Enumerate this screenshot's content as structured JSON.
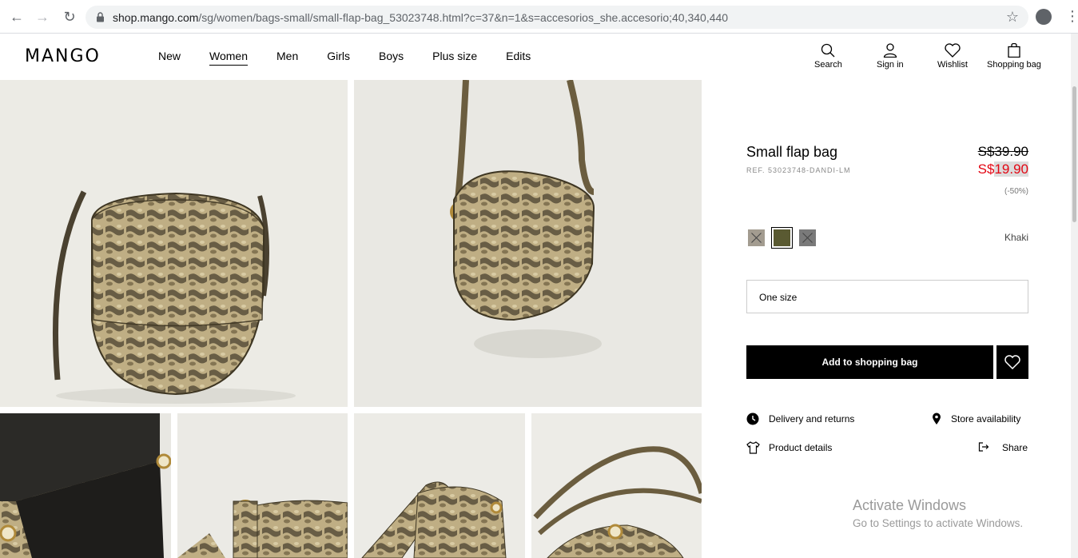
{
  "browser": {
    "url_host": "shop.mango.com",
    "url_path": "/sg/women/bags-small/small-flap-bag_53023748.html?c=37&n=1&s=accesorios_she.accesorio;40,340,440"
  },
  "header": {
    "logo": "MANGO",
    "nav": [
      "New",
      "Women",
      "Men",
      "Girls",
      "Boys",
      "Plus size",
      "Edits"
    ],
    "active_nav": "Women",
    "actions": {
      "search": "Search",
      "sign_in": "Sign in",
      "wishlist": "Wishlist",
      "shopping_bag": "Shopping bag"
    }
  },
  "product": {
    "title": "Small flap bag",
    "ref": "REF. 53023748-DANDI-LM",
    "price_old": "S$39.90",
    "price_new_currency": "S$",
    "price_new_amount": "19.90",
    "discount": "(-50%)",
    "swatches": [
      {
        "color": "#a39c90",
        "state": "unavailable"
      },
      {
        "color": "#5a5a32",
        "state": "selected"
      },
      {
        "color": "#7a7a7a",
        "state": "unavailable"
      }
    ],
    "color_name": "Khaki",
    "size": "One size",
    "add_button": "Add to shopping bag",
    "links": {
      "delivery": "Delivery and returns",
      "store": "Store availability",
      "details": "Product details",
      "share": "Share"
    }
  },
  "watermark": {
    "title": "Activate Windows",
    "subtitle": "Go to Settings to activate Windows."
  },
  "colors": {
    "sale_red": "#e30613",
    "snake_base": "#b8a57a",
    "snake_dark": "#3d3522"
  }
}
